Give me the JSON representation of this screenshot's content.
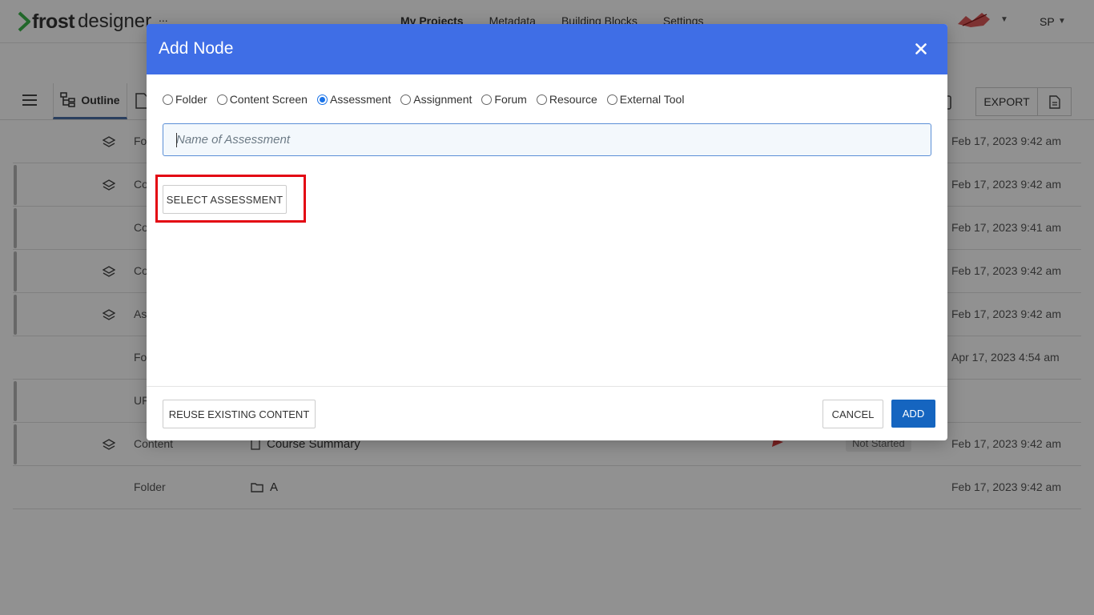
{
  "app": {
    "logo_frost": "frost",
    "logo_designer": "designer",
    "logo_extra": "...",
    "nav": [
      "My Projects",
      "Metadata",
      "Building Blocks",
      "Settings"
    ],
    "user_initials": "SP"
  },
  "toolbar": {
    "outline_label": "Outline",
    "export_label": "EXPORT"
  },
  "rows": [
    {
      "type": "Fo",
      "title": "",
      "date": "Feb 17, 2023 9:42 am",
      "bar": false,
      "layer": true
    },
    {
      "type": "Co",
      "title": "",
      "date": "Feb 17, 2023 9:42 am",
      "bar": true,
      "layer": true
    },
    {
      "type": "Co",
      "title": "",
      "date": "Feb 17, 2023 9:41 am",
      "bar": true,
      "layer": false
    },
    {
      "type": "Co",
      "title": "",
      "date": "Feb 17, 2023 9:42 am",
      "bar": true,
      "layer": true
    },
    {
      "type": "As",
      "title": "",
      "date": "Feb 17, 2023 9:42 am",
      "bar": true,
      "layer": true
    },
    {
      "type": "Fo",
      "title": "",
      "date": "Apr 17, 2023 4:54 am",
      "bar": false,
      "layer": false
    },
    {
      "type": "UF",
      "title": "",
      "date": "",
      "bar": true,
      "layer": false
    },
    {
      "type": "Content",
      "title": "Course Summary",
      "date": "Feb 17, 2023 9:42 am",
      "bar": true,
      "layer": true,
      "status": "Not Started"
    },
    {
      "type": "Folder",
      "title": "A",
      "date": "Feb 17, 2023 9:42 am",
      "bar": false,
      "layer": false
    }
  ],
  "modal": {
    "title": "Add Node",
    "node_types": [
      "Folder",
      "Content Screen",
      "Assessment",
      "Assignment",
      "Forum",
      "Resource",
      "External Tool"
    ],
    "selected_type": "Assessment",
    "name_placeholder": "Name of Assessment",
    "name_value": "",
    "select_assessment_label": "SELECT ASSESSMENT",
    "reuse_label": "REUSE EXISTING CONTENT",
    "cancel_label": "CANCEL",
    "add_label": "ADD"
  },
  "colors": {
    "header": "#3f6ee6",
    "primary_button": "#1565c0",
    "highlight": "#e30613",
    "radio_checked": "#1a73e8"
  }
}
